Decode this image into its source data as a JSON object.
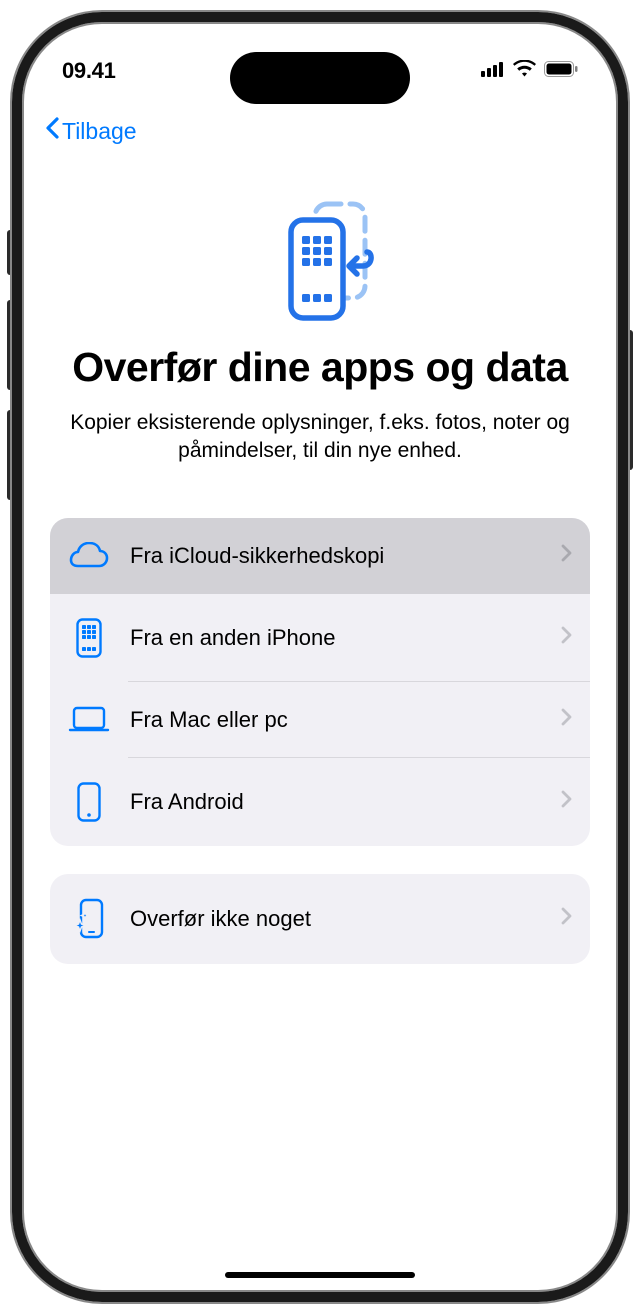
{
  "statusBar": {
    "time": "09.41"
  },
  "nav": {
    "back": "Tilbage"
  },
  "hero": {
    "title": "Overfør dine apps og data",
    "subtitle": "Kopier eksisterende oplysninger, f.eks. fotos, noter og påmindelser, til din nye enhed."
  },
  "options": {
    "group1": [
      {
        "label": "Fra iCloud-sikkerhedskopi",
        "icon": "cloud",
        "selected": true
      },
      {
        "label": "Fra en anden iPhone",
        "icon": "iphone-grid",
        "selected": false
      },
      {
        "label": "Fra Mac eller pc",
        "icon": "laptop",
        "selected": false
      },
      {
        "label": "Fra Android",
        "icon": "phone-blank",
        "selected": false
      }
    ],
    "group2": [
      {
        "label": "Overfør ikke noget",
        "icon": "phone-sparkle",
        "selected": false
      }
    ]
  },
  "colors": {
    "accent": "#007aff"
  }
}
